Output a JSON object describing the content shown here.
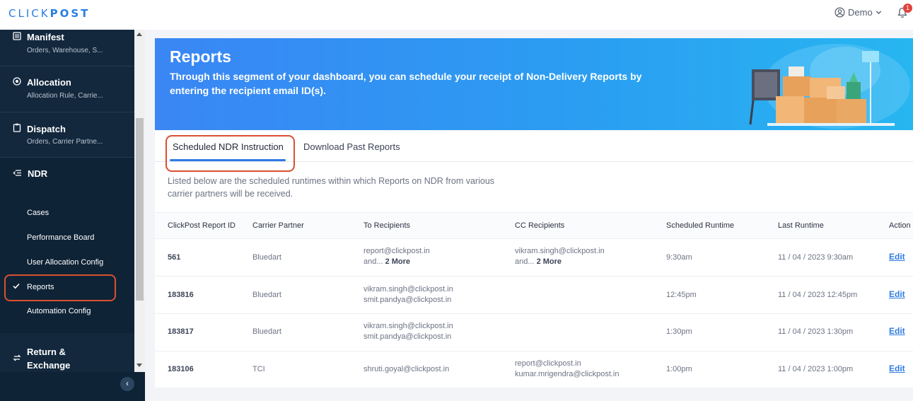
{
  "app": {
    "logo_light": "CLICK",
    "logo_bold": "POST",
    "user_label": "Demo",
    "notification_count": "1"
  },
  "sidebar": {
    "sections": [
      {
        "label": "Manifest",
        "sub": "Orders, Warehouse, S..."
      },
      {
        "label": "Allocation",
        "sub": "Allocation Rule, Carrie..."
      },
      {
        "label": "Dispatch",
        "sub": "Orders, Carrier Partne..."
      }
    ],
    "ndr": {
      "label": "NDR",
      "items": [
        "Cases",
        "Performance Board",
        "User Allocation Config",
        "Reports",
        "Automation Config"
      ],
      "active": "Reports"
    },
    "return_label_1": "Return &",
    "return_label_2": "Exchange",
    "collapse_glyph": "‹"
  },
  "banner": {
    "title": "Reports",
    "description": "Through this segment of your dashboard, you can schedule your receipt of Non-Delivery Reports by entering the recipient email ID(s)."
  },
  "tabs": {
    "active": "Scheduled NDR Instruction",
    "second": "Download Past Reports"
  },
  "note": "Listed below are the scheduled runtimes within which Reports on NDR from various carrier partners will be received.",
  "table": {
    "headers": [
      "ClickPost Report ID",
      "Carrier Partner",
      "To Recipients",
      "CC Recipients",
      "Scheduled Runtime",
      "Last Runtime",
      "Action"
    ],
    "rows": [
      {
        "id": "561",
        "carrier": "Bluedart",
        "to1": "report@clickpost.in",
        "to_more_prefix": "and... ",
        "to_more": "2 More",
        "cc1": "vikram.singh@clickpost.in",
        "cc_more_prefix": "and... ",
        "cc_more": "2 More",
        "scheduled": "9:30am",
        "last": "11 / 04 / 2023 9:30am",
        "action": "Edit"
      },
      {
        "id": "183816",
        "carrier": "Bluedart",
        "to1": "vikram.singh@clickpost.in",
        "to2": "smit.pandya@clickpost.in",
        "scheduled": "12:45pm",
        "last": "11 / 04 / 2023 12:45pm",
        "action": "Edit"
      },
      {
        "id": "183817",
        "carrier": "Bluedart",
        "to1": "vikram.singh@clickpost.in",
        "to2": "smit.pandya@clickpost.in",
        "scheduled": "1:30pm",
        "last": "11 / 04 / 2023 1:30pm",
        "action": "Edit"
      },
      {
        "id": "183106",
        "carrier": "TCI",
        "to1": "shruti.goyal@clickpost.in",
        "cc1": "report@clickpost.in",
        "cc2": "kumar.mrigendra@clickpost.in",
        "scheduled": "1:00pm",
        "last": "11 / 04 / 2023 1:00pm",
        "action": "Edit"
      }
    ]
  },
  "colors": {
    "accent": "#2f7be3",
    "highlight": "#d9502f",
    "sidebar_bg": "#13283d",
    "badge": "#e2423a"
  }
}
